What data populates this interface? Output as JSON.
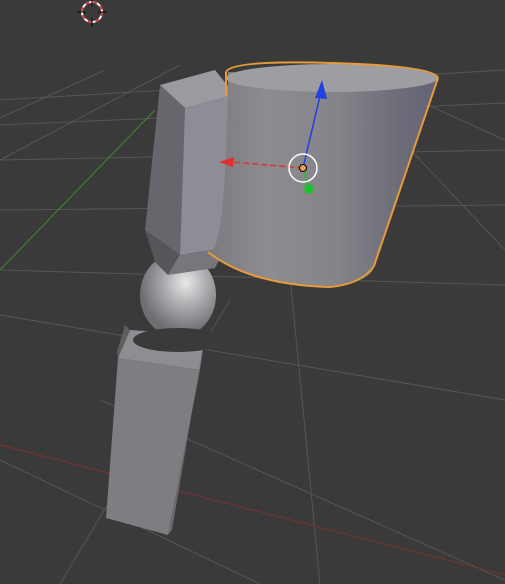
{
  "app": {
    "name": "3D Viewport",
    "view": "perspective"
  },
  "viewport": {
    "background": "#3a3a3a",
    "grid_color": "#555555",
    "axis_x_color": "#8a3434",
    "axis_y_color": "#3f8a2e"
  },
  "scene": {
    "selected_object": "cylinder",
    "selection_outline_color": "#e89a3a",
    "objects": [
      {
        "name": "cylinder",
        "selected": true
      },
      {
        "name": "upper-block",
        "selected": false
      },
      {
        "name": "joint-sphere",
        "selected": false
      },
      {
        "name": "lower-block",
        "selected": false
      }
    ]
  },
  "gizmo": {
    "type": "translate",
    "x_arrow_color": "#e03030",
    "y_arrow_color": "#20c030",
    "z_arrow_color": "#2040e0",
    "pivot_color": "#e8a050"
  },
  "cursor_3d": {
    "icon": "3d-cursor-icon",
    "colors": [
      "#d23a3a",
      "#ffffff"
    ]
  }
}
